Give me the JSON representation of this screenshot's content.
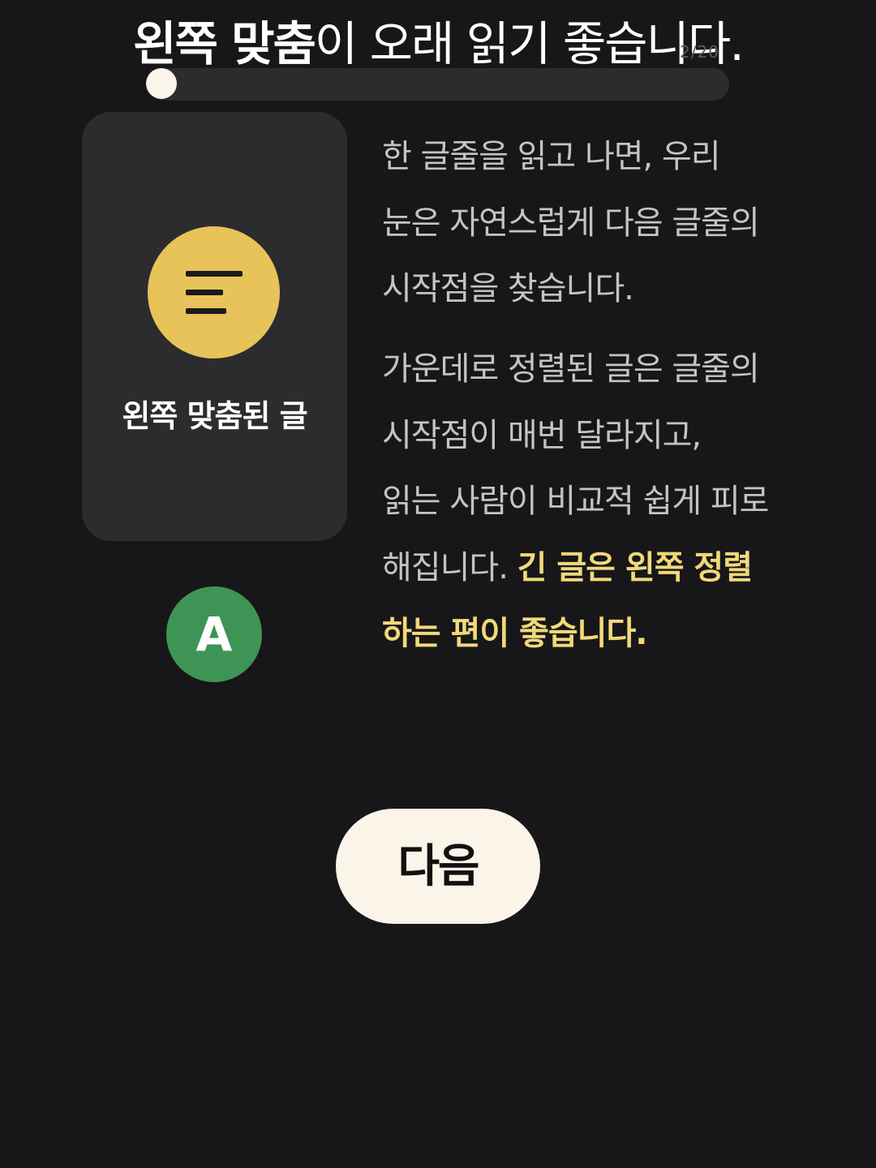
{
  "header": {
    "title_bold": "왼쪽 맞춤",
    "title_rest": "이 오래 읽기 좋습니다.",
    "page_counter": "2/20",
    "progress": 0.02
  },
  "card": {
    "icon": "align-left-icon",
    "label": "왼쪽 맞춤된 글",
    "accent_color": "#e8c35a"
  },
  "avatar": {
    "letter": "A",
    "color": "#3e9455"
  },
  "body_text": {
    "paragraph1": [
      "한 글줄을 읽고 나면, 우리",
      "눈은 자연스럽게 다음 글줄의",
      "시작점을 찾습니다."
    ],
    "paragraph2": [
      "가운데로 정렬된 글은 글줄의",
      "시작점이 매번 달라지고,",
      "읽는 사람이 비교적 쉽게 피로"
    ],
    "paragraph2_line4_plain": "해집니다. ",
    "paragraph2_line4_highlight": "긴 글은 왼쪽 정렬",
    "paragraph2_line5_highlight": "하는 편이 좋습니다.",
    "highlight_color": "#f1d97a"
  },
  "footer": {
    "next_label": "다음"
  }
}
